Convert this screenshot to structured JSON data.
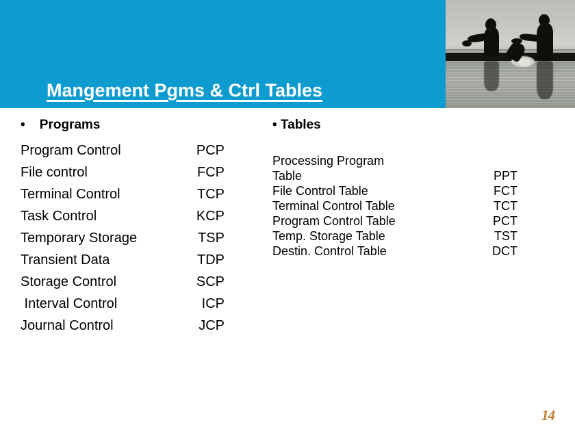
{
  "slide": {
    "title": "Mangement Pgms & Ctrl Tables",
    "page_number": "14",
    "accent_color": "#0D9BD0",
    "title_color": "#ffffff",
    "text_color": "#000000",
    "page_number_color": "#C07B2E"
  },
  "header": {
    "photo_alt": "two-rowers-silhouette-photo"
  },
  "left_column": {
    "heading": "•    Programs",
    "bullet_glyph": "•",
    "heading_text": "Programs",
    "rows": [
      {
        "label": "Program Control",
        "abbr": "PCP"
      },
      {
        "label": "File control",
        "abbr": "FCP"
      },
      {
        "label": "Terminal Control",
        "abbr": "TCP"
      },
      {
        "label": "Task Control",
        "abbr": "KCP"
      },
      {
        "label": "Temporary Storage",
        "abbr": "TSP"
      },
      {
        "label": "Transient Data",
        "abbr": "TDP"
      },
      {
        "label": "Storage Control",
        "abbr": "SCP"
      },
      {
        "label": " Interval Control",
        "abbr": "ICP"
      },
      {
        "label": "Journal Control",
        "abbr": "JCP"
      }
    ]
  },
  "right_column": {
    "heading": "• Tables",
    "bullet_glyph": "•",
    "heading_text": "Tables",
    "rows": [
      {
        "label": "Processing Program\nTable",
        "abbr": "PPT"
      },
      {
        "label": "File Control Table",
        "abbr": "FCT"
      },
      {
        "label": "Terminal Control Table",
        "abbr": "TCT"
      },
      {
        "label": "Program Control Table",
        "abbr": "PCT"
      },
      {
        "label": "Temp. Storage Table",
        "abbr": "TST"
      },
      {
        "label": "Destin. Control Table",
        "abbr": "DCT"
      }
    ]
  }
}
